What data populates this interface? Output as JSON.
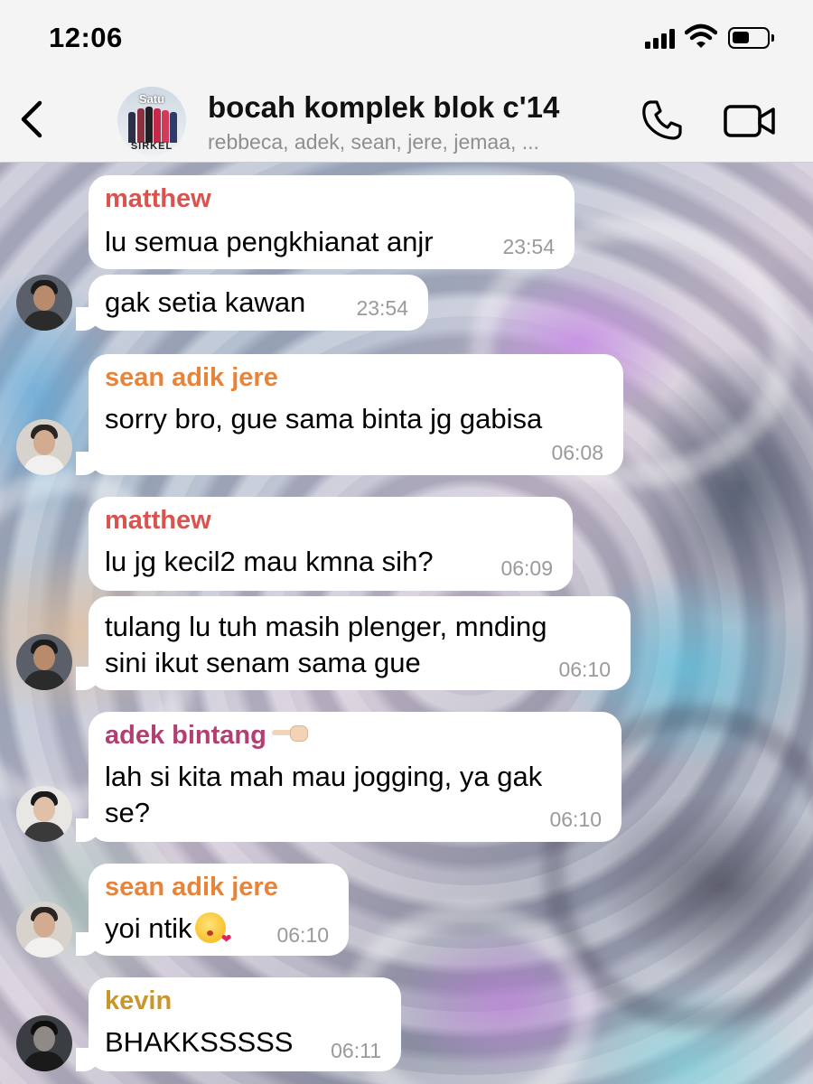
{
  "status_bar": {
    "time": "12:06"
  },
  "header": {
    "title": "bocah komplek blok c'14",
    "subtitle": "rebbeca, adek, sean, jere, jemaa, ...",
    "avatar_text_top": "Satu",
    "avatar_text_bottom": "SIRKEL",
    "icons": [
      "chevron-left-icon",
      "phone-icon",
      "video-camera-icon"
    ]
  },
  "messages": [
    {
      "sender": "matthew",
      "sender_color": "#d9534f",
      "lines": [
        "lu semua pengkhianat anjr"
      ],
      "time": "23:54"
    },
    {
      "sender": "",
      "lines": [
        "gak setia kawan"
      ],
      "time": "23:54"
    },
    {
      "sender": "sean adik jere",
      "sender_color": "#e8843a",
      "lines": [
        "sorry bro, gue sama binta jg gabisa"
      ],
      "time": "06:08"
    },
    {
      "sender": "matthew",
      "sender_color": "#d9534f",
      "lines": [
        "lu jg kecil2 mau kmna sih?"
      ],
      "time": "06:09"
    },
    {
      "sender": "",
      "lines": [
        "tulang lu tuh masih plenger, mnding",
        "sini ikut senam sama gue"
      ],
      "time": "06:10"
    },
    {
      "sender": "adek bintang",
      "sender_color": "#b23f73",
      "lines": [
        "lah si kita mah mau jogging, ya gak",
        "se?"
      ],
      "time": "06:10",
      "sender_emoji": "pointing-hand-icon"
    },
    {
      "sender": "sean adik jere",
      "sender_color": "#e8843a",
      "lines": [
        "yoi ntik"
      ],
      "time": "06:10",
      "text_emoji": "face-blowing-kiss-icon"
    },
    {
      "sender": "kevin",
      "sender_color": "#c8962a",
      "lines": [
        "BHAKKSSSSS"
      ],
      "time": "06:11"
    }
  ]
}
